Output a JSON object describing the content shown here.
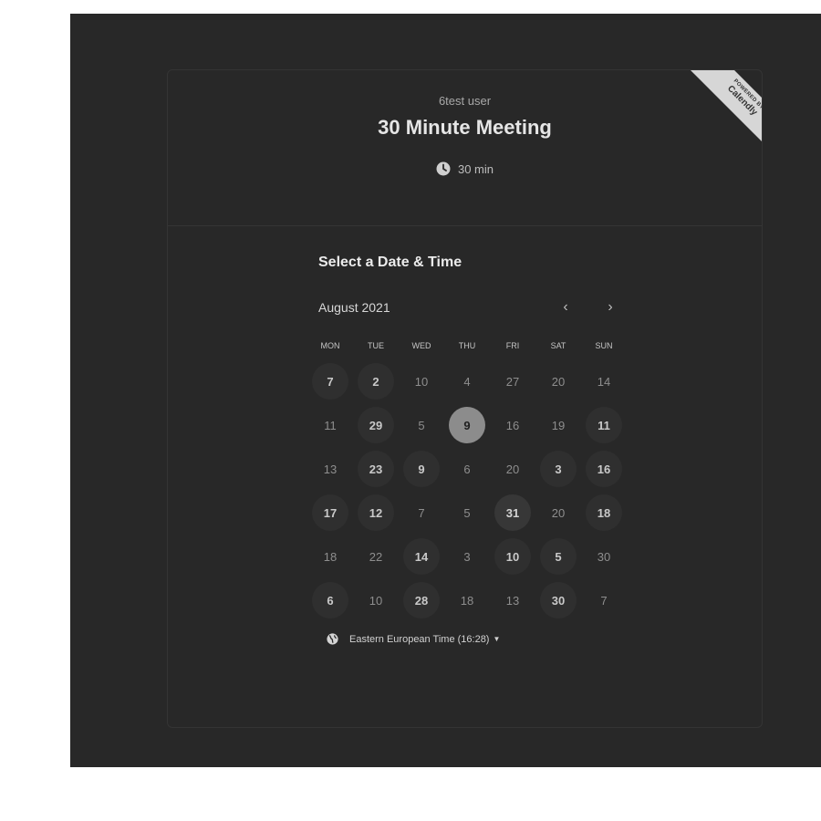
{
  "header": {
    "organizer": "6test user",
    "event_title": "30 Minute Meeting",
    "duration": "30 min",
    "duration_icon": "clock-icon"
  },
  "badge": {
    "small_text": "POWERED BY",
    "brand": "Calendly"
  },
  "calendar": {
    "section_title": "Select a Date & Time",
    "month_label": "August 2021",
    "prev_icon": "chevron-left-icon",
    "next_icon": "chevron-right-icon",
    "weekdays": [
      "MON",
      "TUE",
      "WED",
      "THU",
      "FRI",
      "SAT",
      "SUN"
    ],
    "days": [
      {
        "label": "7",
        "state": "available"
      },
      {
        "label": "2",
        "state": "available"
      },
      {
        "label": "10",
        "state": "unavailable"
      },
      {
        "label": "4",
        "state": "unavailable"
      },
      {
        "label": "27",
        "state": "unavailable"
      },
      {
        "label": "20",
        "state": "unavailable"
      },
      {
        "label": "14",
        "state": "unavailable"
      },
      {
        "label": "11",
        "state": "unavailable"
      },
      {
        "label": "29",
        "state": "available"
      },
      {
        "label": "5",
        "state": "unavailable"
      },
      {
        "label": "9",
        "state": "selected"
      },
      {
        "label": "16",
        "state": "unavailable"
      },
      {
        "label": "19",
        "state": "unavailable"
      },
      {
        "label": "11",
        "state": "available"
      },
      {
        "label": "13",
        "state": "unavailable"
      },
      {
        "label": "23",
        "state": "available"
      },
      {
        "label": "9",
        "state": "available"
      },
      {
        "label": "6",
        "state": "unavailable"
      },
      {
        "label": "20",
        "state": "unavailable"
      },
      {
        "label": "3",
        "state": "available"
      },
      {
        "label": "16",
        "state": "available"
      },
      {
        "label": "17",
        "state": "available"
      },
      {
        "label": "12",
        "state": "available"
      },
      {
        "label": "7",
        "state": "unavailable"
      },
      {
        "label": "5",
        "state": "unavailable"
      },
      {
        "label": "31",
        "state": "today"
      },
      {
        "label": "20",
        "state": "unavailable"
      },
      {
        "label": "18",
        "state": "available"
      },
      {
        "label": "18",
        "state": "unavailable"
      },
      {
        "label": "22",
        "state": "unavailable"
      },
      {
        "label": "14",
        "state": "available"
      },
      {
        "label": "3",
        "state": "unavailable"
      },
      {
        "label": "10",
        "state": "available"
      },
      {
        "label": "5",
        "state": "available"
      },
      {
        "label": "30",
        "state": "unavailable"
      },
      {
        "label": "6",
        "state": "available"
      },
      {
        "label": "10",
        "state": "unavailable"
      },
      {
        "label": "28",
        "state": "available"
      },
      {
        "label": "18",
        "state": "unavailable"
      },
      {
        "label": "13",
        "state": "unavailable"
      },
      {
        "label": "30",
        "state": "available"
      },
      {
        "label": "7",
        "state": "unavailable"
      }
    ]
  },
  "timezone": {
    "label": "Eastern European Time (16:28)",
    "icon": "globe-icon",
    "caret_icon": "caret-down-icon"
  },
  "colors": {
    "backdrop": "#282828",
    "selected_day": "#8c8c8c",
    "available_day_bg": "#2f2f2f"
  }
}
